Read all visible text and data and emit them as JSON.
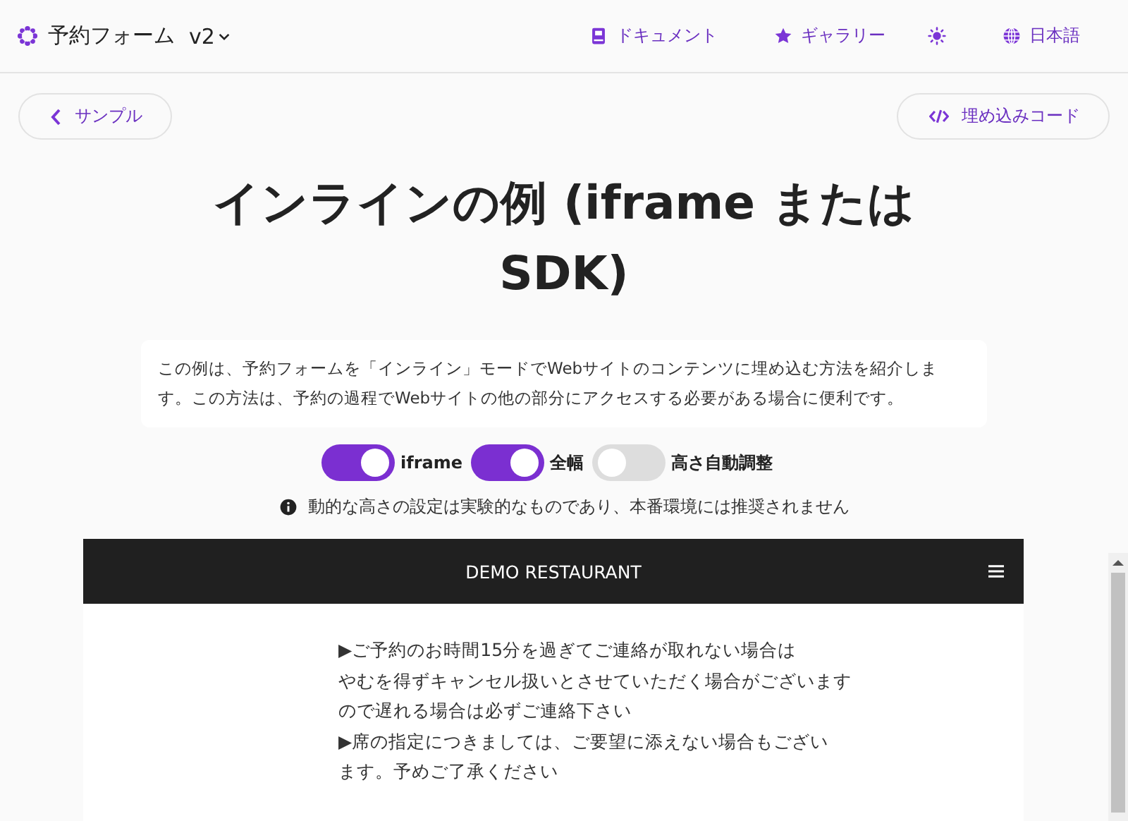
{
  "header": {
    "brand": "予約フォーム",
    "version": "v2",
    "nav": [
      {
        "kind": "book",
        "label": "ドキュメント"
      },
      {
        "kind": "star",
        "label": "ギャラリー"
      },
      {
        "kind": "sun"
      },
      {
        "kind": "globe",
        "label": "日本語"
      }
    ]
  },
  "back_button": "サンプル",
  "embed_button": "埋め込みコード",
  "title": "インラインの例 (iframe または SDK)",
  "description": "この例は、予約フォームを「インライン」モードでWebサイトのコンテンツに埋め込む方法を紹介します。この方法は、予約の過程でWebサイトの他の部分にアクセスする必要がある場合に便利です。",
  "toggles": [
    {
      "label": "iframe",
      "on": true
    },
    {
      "label": "全幅",
      "on": true
    },
    {
      "label": "高さ自動調整",
      "on": false
    }
  ],
  "notice": "動的な高さの設定は実験的なものであり、本番環境には推奨されません",
  "embed": {
    "title": "DEMO RESTAURANT",
    "lines": [
      "▶ご予約のお時間15分を過ぎてご連絡が取れない場合は",
      "やむを得ずキャンセル扱いとさせていただく場合がございます",
      "ので遅れる場合は必ずご連絡下さい",
      "▶席の指定につきましては、ご要望に添えない場合もござい",
      "ます。予めご了承ください"
    ]
  }
}
